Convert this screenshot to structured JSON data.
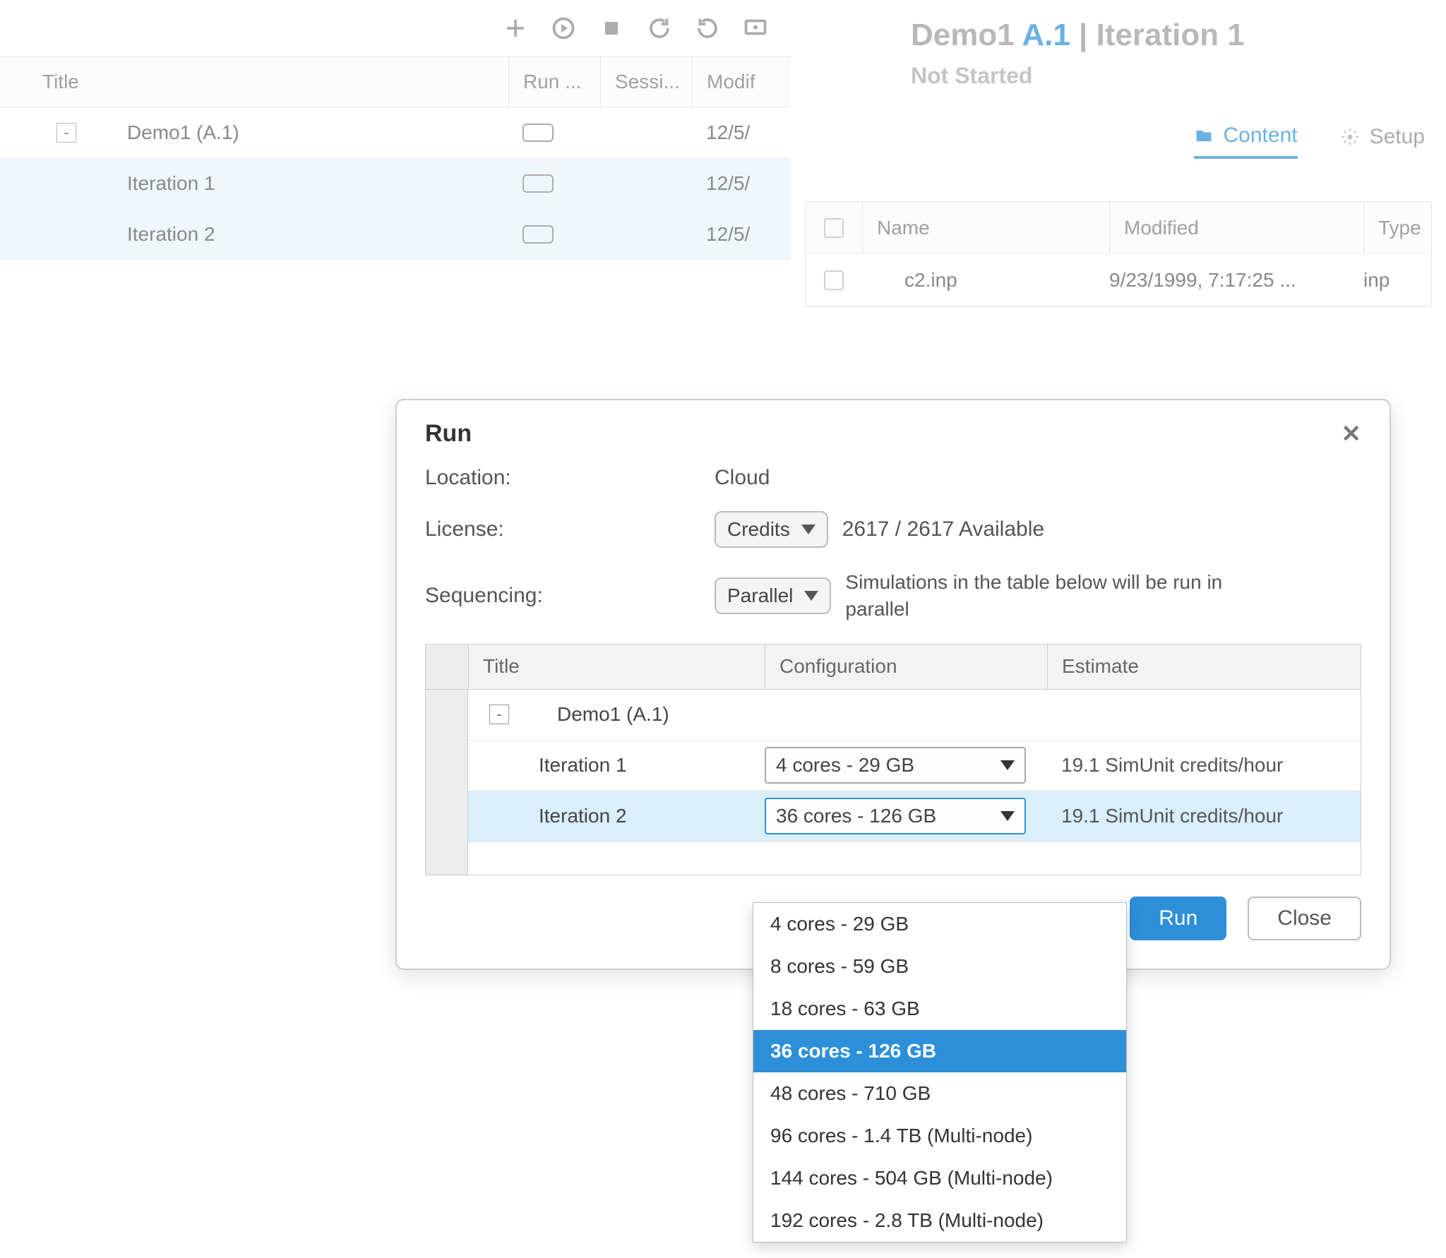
{
  "toolbar_icons": [
    "plus",
    "play",
    "stop",
    "refresh",
    "undo",
    "monitor"
  ],
  "left_table": {
    "headers": {
      "title": "Title",
      "run": "Run ...",
      "session": "Sessi...",
      "modified": "Modif"
    },
    "rows": [
      {
        "title": "Demo1 (A.1)",
        "indent": 0,
        "has_twisty": true,
        "has_gear": true,
        "modified": "12/5/",
        "selected": false
      },
      {
        "title": "Iteration 1",
        "indent": 1,
        "has_twisty": false,
        "has_gear": false,
        "modified": "12/5/",
        "selected": true
      },
      {
        "title": "Iteration 2",
        "indent": 1,
        "has_twisty": false,
        "has_gear": false,
        "modified": "12/5/",
        "selected": true
      }
    ]
  },
  "right_header": {
    "title_prefix": "Demo1 ",
    "title_code": "A.1",
    "title_sep": " | ",
    "title_iter": "Iteration 1",
    "status": "Not Started"
  },
  "right_tabs": {
    "content": "Content",
    "setup": "Setup"
  },
  "right_table": {
    "headers": {
      "name": "Name",
      "modified": "Modified",
      "type": "Type"
    },
    "row": {
      "name": "c2.inp",
      "modified": "9/23/1999, 7:17:25 ...",
      "type": "inp"
    }
  },
  "modal": {
    "title": "Run",
    "location_label": "Location:",
    "location_value": "Cloud",
    "license_label": "License:",
    "license_select": "Credits",
    "license_avail": "2617 / 2617 Available",
    "sequencing_label": "Sequencing:",
    "sequencing_select": "Parallel",
    "sequencing_hint": "Simulations in the table below will be run in parallel",
    "grid": {
      "headers": {
        "title": "Title",
        "config": "Configuration",
        "estimate": "Estimate"
      },
      "root_title": "Demo1 (A.1)",
      "rows": [
        {
          "title": "Iteration 1",
          "config": "4 cores - 29 GB",
          "estimate": "19.1 SimUnit credits/hour",
          "active": false
        },
        {
          "title": "Iteration 2",
          "config": "36 cores - 126 GB",
          "estimate": "19.1 SimUnit credits/hour",
          "active": true
        }
      ]
    },
    "run_btn": "Run",
    "close_btn": "Close"
  },
  "config_options": [
    "4 cores - 29 GB",
    "8 cores - 59 GB",
    "18 cores - 63 GB",
    "36 cores - 126 GB",
    "48 cores - 710 GB",
    "96 cores - 1.4 TB (Multi-node)",
    "144 cores - 504 GB (Multi-node)",
    "192 cores - 2.8 TB (Multi-node)"
  ],
  "config_selected_index": 3
}
